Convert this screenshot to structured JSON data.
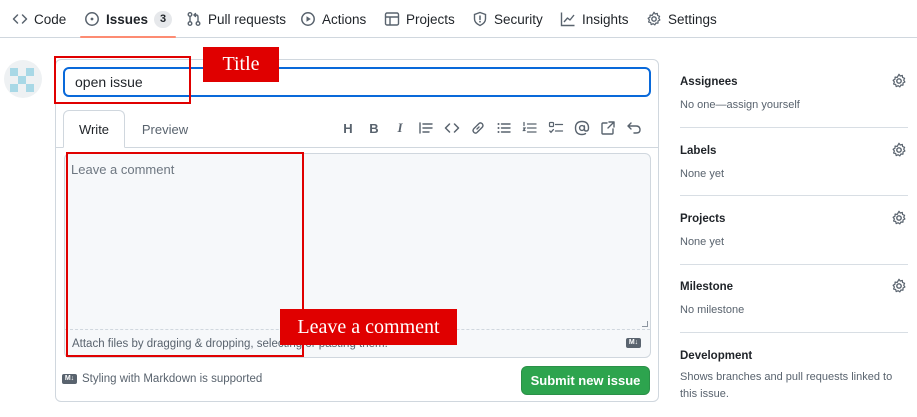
{
  "nav": {
    "tabs": [
      {
        "label": "Code",
        "icon": "code-icon"
      },
      {
        "label": "Issues",
        "icon": "issue-opened-icon",
        "count": "3"
      },
      {
        "label": "Pull requests",
        "icon": "git-pull-request-icon"
      },
      {
        "label": "Actions",
        "icon": "play-icon"
      },
      {
        "label": "Projects",
        "icon": "table-icon"
      },
      {
        "label": "Security",
        "icon": "shield-icon"
      },
      {
        "label": "Insights",
        "icon": "graph-icon"
      },
      {
        "label": "Settings",
        "icon": "gear-icon"
      }
    ],
    "active_tab": "Issues",
    "active_underline_color": "#fd8c73"
  },
  "issue_form": {
    "title_value": "open issue",
    "tabs": {
      "write": "Write",
      "preview": "Preview"
    },
    "comment_placeholder": "Leave a comment",
    "attach_hint": "Attach files by dragging & dropping, selecting or pasting them.",
    "markdown_note": "Styling with Markdown is supported",
    "submit_label": "Submit new issue",
    "submit_color": "#2da44e",
    "toolbar_icons": [
      "heading-icon",
      "bold-icon",
      "italic-icon",
      "quote-icon",
      "code-icon",
      "link-icon",
      "unordered-list-icon",
      "ordered-list-icon",
      "task-list-icon",
      "mention-icon",
      "cross-reference-icon",
      "undo-icon"
    ]
  },
  "sidebar": [
    {
      "title": "Assignees",
      "value": "No one—assign yourself"
    },
    {
      "title": "Labels",
      "value": "None yet"
    },
    {
      "title": "Projects",
      "value": "None yet"
    },
    {
      "title": "Milestone",
      "value": "No milestone"
    },
    {
      "title": "Development",
      "value": "Shows branches and pull requests linked to this issue."
    }
  ],
  "annotations": {
    "title_label": "Title",
    "comment_label": "Leave a comment",
    "color": "#e00000"
  }
}
